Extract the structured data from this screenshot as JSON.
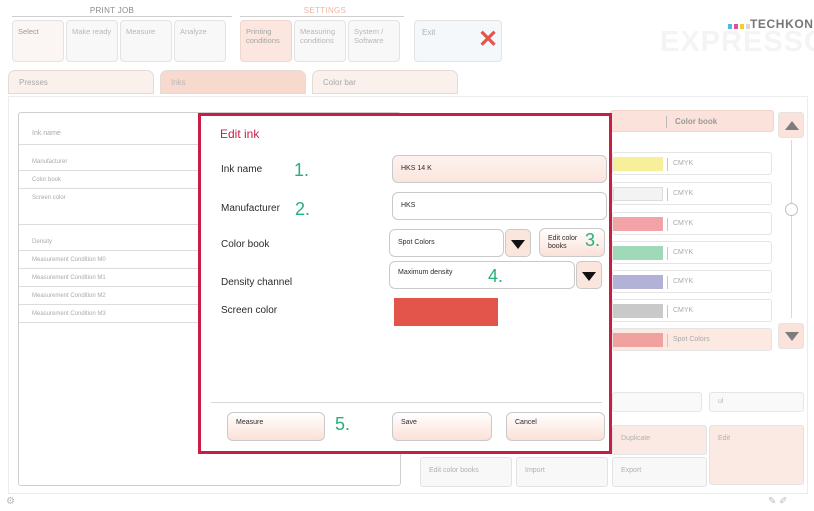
{
  "nav": {
    "print_job_label": "PRINT JOB",
    "settings_label": "SETTINGS",
    "print_job_tiles": [
      "Select",
      "Make ready",
      "Measure",
      "Analyze"
    ],
    "settings_tiles": [
      {
        "label": "Printing conditions"
      },
      {
        "label": "Measuring conditions"
      },
      {
        "label": "System / Software"
      }
    ],
    "exit_label": "Exit"
  },
  "brand": {
    "name": "TECHKON",
    "logo": "EXPRESSO",
    "dot_colors": [
      "#4fb6e9",
      "#e64b9a",
      "#f2d12e",
      "#d8d8d8"
    ]
  },
  "tabs": [
    "Presses",
    "Inks",
    "Color bar"
  ],
  "left_table": {
    "rows": [
      "Ink name",
      "Manufacturer",
      "Color book",
      "Screen color",
      "Density",
      "Measurement Condition M0",
      "Measurement Condition M1",
      "Measurement Condition M2",
      "Measurement Condition M3"
    ]
  },
  "right_list": {
    "header": "Color book",
    "rows": [
      {
        "label": "CMYK",
        "color": "#f7ef9a"
      },
      {
        "label": "CMYK",
        "color": "#f3f3f3"
      },
      {
        "label": "CMYK",
        "color": "#f2a3a8"
      },
      {
        "label": "CMYK",
        "color": "#9fd9b8"
      },
      {
        "label": "CMYK",
        "color": "#b2b2d8"
      },
      {
        "label": "CMYK",
        "color": "#c9c9c9"
      },
      {
        "label": "Spot Colors",
        "color": "#f0a39e"
      }
    ],
    "filter_placeholder": "ul"
  },
  "bg_buttons": {
    "duplicate": "Duplicate",
    "edit": "Edit",
    "edit_color_books": "Edit color books",
    "import": "Import",
    "export": "Export"
  },
  "modal": {
    "title": "Edit ink",
    "labels": {
      "ink_name": "Ink name",
      "manufacturer": "Manufacturer",
      "color_book": "Color book",
      "density_channel": "Density channel",
      "screen_color": "Screen color"
    },
    "values": {
      "ink_name": "HKS 14 K",
      "manufacturer": "HKS",
      "color_book": "Spot Colors",
      "density_channel": "Maximum density",
      "screen_color": "#e3544b"
    },
    "buttons": {
      "edit_color_books": "Edit color books",
      "measure": "Measure",
      "save": "Save",
      "cancel": "Cancel"
    },
    "annotations": [
      "1.",
      "2.",
      "3.",
      "4.",
      "5."
    ]
  },
  "colors": {
    "modal_border": "#c81e46",
    "annotation": "#26b17a",
    "accent_peach": "#fbe2da"
  }
}
